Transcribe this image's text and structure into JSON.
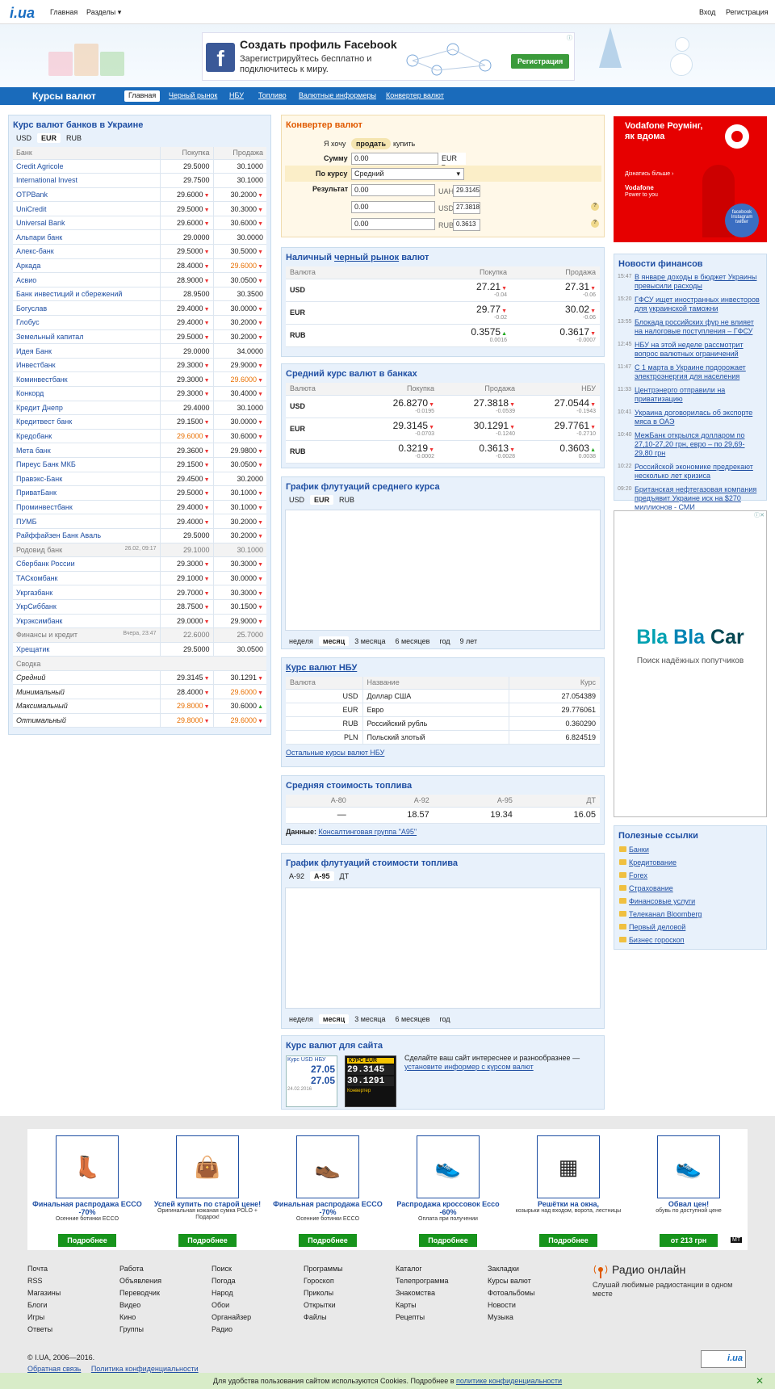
{
  "header": {
    "logo": "i.ua",
    "nav_home": "Главная",
    "nav_sections": "Разделы ▾",
    "nav_login": "Вход",
    "nav_register": "Регистрация"
  },
  "fb_ad": {
    "title": "Создать профиль Facebook",
    "subtitle": "Зарегистрируйтесь бесплатно и подключитесь к миру.",
    "button": "Регистрация"
  },
  "section_nav": {
    "title": "Курсы валют",
    "items": [
      "Главная",
      "Черный рынок",
      "НБУ",
      "Топливо",
      "Валютные информеры",
      "Конвертер валют"
    ]
  },
  "banks": {
    "title": "Курс валют банков в Украине",
    "tabs": [
      "USD",
      "EUR",
      "RUB"
    ],
    "active_tab": "EUR",
    "headers": [
      "Банк",
      "Покупка",
      "Продажа"
    ],
    "rows": [
      {
        "name": "Credit Agricole",
        "buy": "29.5000",
        "sell": "30.1000",
        "bd": "",
        "sd": ""
      },
      {
        "name": "International Invest",
        "buy": "29.7500",
        "sell": "30.1000",
        "bd": "",
        "sd": ""
      },
      {
        "name": "OTPBank",
        "buy": "29.6000",
        "sell": "30.2000",
        "bd": "dn",
        "sd": "dn"
      },
      {
        "name": "UniCredit",
        "buy": "29.5000",
        "sell": "30.3000",
        "bd": "dn",
        "sd": "dn"
      },
      {
        "name": "Universal Bank",
        "buy": "29.6000",
        "sell": "30.6000",
        "bd": "dn",
        "sd": "dn"
      },
      {
        "name": "Альпари банк",
        "buy": "29.0000",
        "sell": "30.0000",
        "bd": "",
        "sd": ""
      },
      {
        "name": "Алекс-банк",
        "buy": "29.5000",
        "sell": "30.5000",
        "bd": "dn",
        "sd": "dn"
      },
      {
        "name": "Аркада",
        "buy": "28.4000",
        "sell": "29.6000",
        "bd": "dn",
        "sd": "dn",
        "sell_orange": true
      },
      {
        "name": "Асвио",
        "buy": "28.9000",
        "sell": "30.0500",
        "bd": "dn",
        "sd": "dn"
      },
      {
        "name": "Банк инвестиций и сбережений",
        "buy": "28.9500",
        "sell": "30.3500",
        "bd": "",
        "sd": ""
      },
      {
        "name": "Богуслав",
        "buy": "29.4000",
        "sell": "30.0000",
        "bd": "dn",
        "sd": "dn"
      },
      {
        "name": "Глобус",
        "buy": "29.4000",
        "sell": "30.2000",
        "bd": "dn",
        "sd": "dn"
      },
      {
        "name": "Земельный капитал",
        "buy": "29.5000",
        "sell": "30.2000",
        "bd": "dn",
        "sd": "dn"
      },
      {
        "name": "Идея Банк",
        "buy": "29.0000",
        "sell": "34.0000",
        "bd": "",
        "sd": ""
      },
      {
        "name": "Инвестбанк",
        "buy": "29.3000",
        "sell": "29.9000",
        "bd": "dn",
        "sd": "dn"
      },
      {
        "name": "Коминвестбанк",
        "buy": "29.3000",
        "sell": "29.6000",
        "bd": "dn",
        "sd": "dn",
        "sell_orange": true
      },
      {
        "name": "Конкорд",
        "buy": "29.3000",
        "sell": "30.4000",
        "bd": "dn",
        "sd": "dn"
      },
      {
        "name": "Кредит Днепр",
        "buy": "29.4000",
        "sell": "30.1000",
        "bd": "",
        "sd": ""
      },
      {
        "name": "Кредитвест банк",
        "buy": "29.1500",
        "sell": "30.0000",
        "bd": "dn",
        "sd": "dn"
      },
      {
        "name": "Кредобанк",
        "buy": "29.6000",
        "sell": "30.6000",
        "bd": "dn",
        "sd": "dn",
        "buy_orange": true
      },
      {
        "name": "Мета банк",
        "buy": "29.3600",
        "sell": "29.9800",
        "bd": "dn",
        "sd": "dn"
      },
      {
        "name": "Пиреус Банк МКБ",
        "buy": "29.1500",
        "sell": "30.0500",
        "bd": "dn",
        "sd": "dn"
      },
      {
        "name": "Правэкс-Банк",
        "buy": "29.4500",
        "sell": "30.2000",
        "bd": "dn",
        "sd": ""
      },
      {
        "name": "ПриватБанк",
        "buy": "29.5000",
        "sell": "30.1000",
        "bd": "dn",
        "sd": "dn"
      },
      {
        "name": "Проминвестбанк",
        "buy": "29.4000",
        "sell": "30.1000",
        "bd": "dn",
        "sd": "dn"
      },
      {
        "name": "ПУМБ",
        "buy": "29.4000",
        "sell": "30.2000",
        "bd": "dn",
        "sd": "dn"
      },
      {
        "name": "Райффайзен Банк Аваль",
        "buy": "29.5000",
        "sell": "30.2000",
        "bd": "",
        "sd": "dn"
      },
      {
        "name": "Родовид банк",
        "date": "26.02, 09:17",
        "buy": "29.1000",
        "sell": "30.1000",
        "bd": "",
        "sd": "",
        "gray": true
      },
      {
        "name": "Сбербанк России",
        "buy": "29.3000",
        "sell": "30.3000",
        "bd": "dn",
        "sd": "dn"
      },
      {
        "name": "ТАСкомбанк",
        "buy": "29.1000",
        "sell": "30.0000",
        "bd": "dn",
        "sd": "dn"
      },
      {
        "name": "Укргазбанк",
        "buy": "29.7000",
        "sell": "30.3000",
        "bd": "dn",
        "sd": "dn"
      },
      {
        "name": "УкрСиббанк",
        "buy": "28.7500",
        "sell": "30.1500",
        "bd": "dn",
        "sd": "dn"
      },
      {
        "name": "Укрэксимбанк",
        "buy": "29.0000",
        "sell": "29.9000",
        "bd": "dn",
        "sd": "dn"
      },
      {
        "name": "Финансы и кредит",
        "date": "Вчера, 23:47",
        "buy": "22.6000",
        "sell": "25.7000",
        "bd": "",
        "sd": "",
        "gray": true
      },
      {
        "name": "Хрещатик",
        "buy": "29.5000",
        "sell": "30.0500",
        "bd": "",
        "sd": ""
      }
    ],
    "summary_title": "Сводка",
    "summary": [
      {
        "name": "Средний",
        "buy": "29.3145",
        "sell": "30.1291",
        "bd": "dn",
        "sd": "dn"
      },
      {
        "name": "Минимальный",
        "buy": "28.4000",
        "sell": "29.6000",
        "bd": "dn",
        "sd": "dn",
        "sell_orange": true
      },
      {
        "name": "Максимальный",
        "buy": "29.8000",
        "sell": "30.6000",
        "bd": "dn",
        "sd": "up",
        "buy_orange": true
      },
      {
        "name": "Оптимальный",
        "buy": "29.8000",
        "sell": "29.6000",
        "bd": "dn",
        "sd": "dn",
        "buy_orange": true,
        "sell_orange": true
      }
    ]
  },
  "converter": {
    "title": "Конвертер валют",
    "want_label": "Я хочу",
    "sell": "продать",
    "buy": "купить",
    "amount_label": "Сумму",
    "amount_value": "0.00",
    "currency": "EUR",
    "rate_label": "По курсу",
    "rate_value": "Средний",
    "result_label": "Результат",
    "results": [
      {
        "value": "0.00",
        "cur": "UAH",
        "rate": "29.3145"
      },
      {
        "value": "0.00",
        "cur": "USD",
        "rate": "27.3818"
      },
      {
        "value": "0.00",
        "cur": "RUB",
        "rate": "0.3613"
      }
    ]
  },
  "black_market": {
    "title_a": "Наличный",
    "title_link": "черный рынок",
    "title_b": "валют",
    "headers": [
      "Валюта",
      "Покупка",
      "Продажа"
    ],
    "rows": [
      {
        "cur": "USD",
        "buy": "27.21",
        "bdelta": "-0.04",
        "bd": "dn",
        "sell": "27.31",
        "sdelta": "-0.06",
        "sd": "dn"
      },
      {
        "cur": "EUR",
        "buy": "29.77",
        "bdelta": "-0.02",
        "bd": "dn",
        "sell": "30.02",
        "sdelta": "-0.06",
        "sd": "dn"
      },
      {
        "cur": "RUB",
        "buy": "0.3575",
        "bdelta": "0.0016",
        "bd": "up",
        "sell": "0.3617",
        "sdelta": "-0.0007",
        "sd": "dn"
      }
    ]
  },
  "avg_banks": {
    "title": "Средний курс валют в банках",
    "headers": [
      "Валюта",
      "Покупка",
      "Продажа",
      "НБУ"
    ],
    "rows": [
      {
        "cur": "USD",
        "buy": "26.8270",
        "bdelta": "-0.0195",
        "sell": "27.3818",
        "sdelta": "-0.0539",
        "nbu": "27.0544",
        "ndelta": "-0.1943"
      },
      {
        "cur": "EUR",
        "buy": "29.3145",
        "bdelta": "-0.0703",
        "sell": "30.1291",
        "sdelta": "-0.1240",
        "nbu": "29.7761",
        "ndelta": "-0.2710"
      },
      {
        "cur": "RUB",
        "buy": "0.3219",
        "bdelta": "-0.0002",
        "sell": "0.3613",
        "sdelta": "-0.0028",
        "nbu": "0.3603",
        "ndelta": "0.0038",
        "nd": "up"
      }
    ]
  },
  "avg_chart": {
    "title": "График флутуаций среднего курса",
    "tabs": [
      "USD",
      "EUR",
      "RUB"
    ],
    "active_tab": "EUR",
    "periods": [
      "неделя",
      "месяц",
      "3 месяца",
      "6 месяцев",
      "год",
      "9 лет"
    ],
    "active_period": "месяц"
  },
  "nbu": {
    "title": "Курс валют НБУ",
    "headers": [
      "Валюта",
      "Название",
      "Курс"
    ],
    "rows": [
      {
        "cur": "USD",
        "name": "Доллар США",
        "rate": "27.054389"
      },
      {
        "cur": "EUR",
        "name": "Евро",
        "rate": "29.776061"
      },
      {
        "cur": "RUB",
        "name": "Российский рубль",
        "rate": "0.360290"
      },
      {
        "cur": "PLN",
        "name": "Польский злотый",
        "rate": "6.824519"
      }
    ],
    "other_link": "Остальные курсы валют НБУ"
  },
  "fuel": {
    "title": "Средняя стоимость топлива",
    "headers": [
      "А-80",
      "А-92",
      "А-95",
      "ДТ"
    ],
    "values": [
      "—",
      "18.57",
      "19.34",
      "16.05"
    ],
    "source_label": "Данные:",
    "source_link": "Консалтинговая группа \"А95\""
  },
  "fuel_chart": {
    "title": "График флутуаций стоимости топлива",
    "tabs": [
      "А-92",
      "А-95",
      "ДТ"
    ],
    "active_tab": "А-95",
    "periods": [
      "неделя",
      "месяц",
      "3 месяца",
      "6 месяцев",
      "год"
    ],
    "active_period": "месяц"
  },
  "informer": {
    "title": "Курс валют для сайта",
    "text": "Сделайте ваш сайт интереснее и разнообразнее —",
    "link": "установите информер с курсом валют",
    "widget1_title": "Курс USD НБУ",
    "widget1_values": [
      "27.05",
      "27.05"
    ],
    "widget1_date": "24.02.2016",
    "widget2_title": "КУРС EUR",
    "widget2_values": [
      "29.3145",
      "30.1291"
    ],
    "widget2_label": "Конвертер"
  },
  "vodafone": {
    "title": "Vodafone Роумінг, як вдома",
    "more": "Дізнатись більше ›",
    "brand": "Vodafone",
    "slogan": "Power to you",
    "bubble": "facebook Instagram twitter"
  },
  "news": {
    "title": "Новости финансов",
    "items": [
      {
        "time": "15:47",
        "text": "В январе доходы в бюджет Украины превысили расходы"
      },
      {
        "time": "15:20",
        "text": "ГФСУ ищет иностранных инвесторов для украинской таможни"
      },
      {
        "time": "13:55",
        "text": "Блокада российских фур не влияет на налоговые поступления – ГФСУ"
      },
      {
        "time": "12:45",
        "text": "НБУ на этой неделе рассмотрит вопрос валютных ограничений"
      },
      {
        "time": "11:47",
        "text": "С 1 марта в Украине подорожает электроэнергия для населения"
      },
      {
        "time": "11:33",
        "text": "Центрэнерго отправили на приватизацию"
      },
      {
        "time": "10:41",
        "text": "Украина договорилась об экспорте мяса в ОАЭ"
      },
      {
        "time": "10:40",
        "text": "МежБанк открылся долларом по 27,10-27,20 грн, евро – по 29,69-29,80 грн"
      },
      {
        "time": "10:22",
        "text": "Российской экономике предрекают несколько лет кризиса"
      },
      {
        "time": "09:20",
        "text": "Британская нефтегазовая компания предъявит Украине иск на $270 миллионов - СМИ"
      }
    ]
  },
  "blablacar": {
    "brand_a": "Bla",
    "brand_b": "Bla",
    "brand_c": "Car",
    "sub": "Поиск надёжных попутчиков"
  },
  "links": {
    "title": "Полезные ссылки",
    "items": [
      "Банки",
      "Кредитование",
      "Forex",
      "Страхование",
      "Финансовые услуги",
      "Телеканал Bloomberg",
      "Первый деловой",
      "Бизнес гороскоп"
    ]
  },
  "promo": [
    {
      "title": "Финальная распродажа ECCO -70%",
      "sub": "Осенние ботинки ECCO",
      "btn": "Подробнее",
      "icon": "boot-icon"
    },
    {
      "title": "Успей купить по старой цене!",
      "sub": "Оригинальная кожаная сумка POLO + Подарок!",
      "btn": "Подробнее",
      "icon": "bag-icon"
    },
    {
      "title": "Финальная распродажа ECCO -70%",
      "sub": "Осенние ботинки ECCO",
      "btn": "Подробнее",
      "icon": "shoe-icon"
    },
    {
      "title": "Распродажа кроссовок Ecco -60%",
      "sub": "Оплата при получении",
      "btn": "Подробнее",
      "icon": "sneaker-icon"
    },
    {
      "title": "Решётки на окна,",
      "sub": "козырьки над входом, ворота, лестницы",
      "btn": "Подробнее",
      "icon": "grate-icon"
    },
    {
      "title": "Обвал цен!",
      "sub": "обувь по доступной цене",
      "btn": "от 213 грн",
      "icon": "sneaker-icon"
    }
  ],
  "footer": {
    "cols": [
      [
        "Почта",
        "RSS",
        "Магазины",
        "Блоги",
        "Игры",
        "Ответы"
      ],
      [
        "Работа",
        "Объявления",
        "Переводчик",
        "Видео",
        "Кино",
        "Группы"
      ],
      [
        "Поиск",
        "Погода",
        "Народ",
        "Обои",
        "Органайзер",
        "Радио"
      ],
      [
        "Программы",
        "Гороскоп",
        "Приколы",
        "Открытки",
        "Файлы"
      ],
      [
        "Каталог",
        "Телепрограмма",
        "Знакомства",
        "Карты",
        "Рецепты"
      ],
      [
        "Закладки",
        "Курсы валют",
        "Фотоальбомы",
        "Новости",
        "Музыка"
      ]
    ],
    "radio_title": "Радио онлайн",
    "radio_sub": "Слушай любимые радиостанции в одном месте",
    "copyright": "© I.UA, 2006—2016.",
    "feedback": "Обратная связь",
    "privacy": "Политика конфиденциальности",
    "catalog_badge": "i.ua"
  },
  "cookie": {
    "text": "Для удобства пользования сайтом используются Cookies. Подробнее в",
    "link": "политике конфиденциальности"
  }
}
